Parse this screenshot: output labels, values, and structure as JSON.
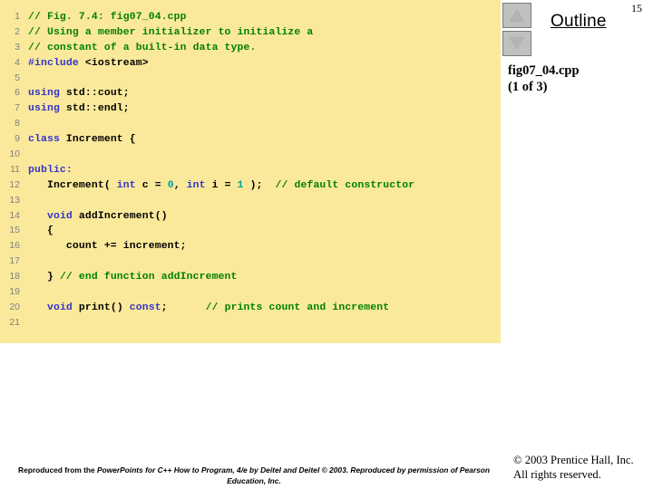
{
  "slide": {
    "page_number": "15"
  },
  "outline": {
    "title": "Outline",
    "file_name": "fig07_04.cpp",
    "file_progress": "(1 of 3)",
    "scroll_up_icon": "triangle-up-icon",
    "scroll_down_icon": "triangle-down-icon"
  },
  "code": {
    "background_color": "#fae99a",
    "line_number_color": "#808080",
    "colors": {
      "comment": "#008000",
      "keyword": "#3333cc",
      "number": "#00a0a0",
      "plain": "#000000"
    },
    "lines": [
      {
        "n": "1",
        "tokens": [
          {
            "t": "// Fig. 7.4: fig07_04.cpp",
            "c": "comment"
          }
        ]
      },
      {
        "n": "2",
        "tokens": [
          {
            "t": "// Using a member initializer to initialize a",
            "c": "comment"
          }
        ]
      },
      {
        "n": "3",
        "tokens": [
          {
            "t": "// constant of a built-in data type.",
            "c": "comment"
          }
        ]
      },
      {
        "n": "4",
        "tokens": [
          {
            "t": "#include ",
            "c": "keyword"
          },
          {
            "t": "<iostream>",
            "c": "plain"
          }
        ]
      },
      {
        "n": "5",
        "tokens": []
      },
      {
        "n": "6",
        "tokens": [
          {
            "t": "using",
            "c": "keyword"
          },
          {
            "t": " std::cout;",
            "c": "plain"
          }
        ]
      },
      {
        "n": "7",
        "tokens": [
          {
            "t": "using",
            "c": "keyword"
          },
          {
            "t": " std::endl;",
            "c": "plain"
          }
        ]
      },
      {
        "n": "8",
        "tokens": []
      },
      {
        "n": "9",
        "tokens": [
          {
            "t": "class",
            "c": "keyword"
          },
          {
            "t": " Increment {",
            "c": "plain"
          }
        ]
      },
      {
        "n": "10",
        "tokens": []
      },
      {
        "n": "11",
        "tokens": [
          {
            "t": "public:",
            "c": "keyword"
          }
        ]
      },
      {
        "n": "12",
        "tokens": [
          {
            "t": "   Increment( ",
            "c": "plain"
          },
          {
            "t": "int",
            "c": "keyword"
          },
          {
            "t": " c = ",
            "c": "plain"
          },
          {
            "t": "0",
            "c": "number"
          },
          {
            "t": ", ",
            "c": "plain"
          },
          {
            "t": "int",
            "c": "keyword"
          },
          {
            "t": " i = ",
            "c": "plain"
          },
          {
            "t": "1",
            "c": "number"
          },
          {
            "t": " );  ",
            "c": "plain"
          },
          {
            "t": "// default constructor",
            "c": "comment"
          }
        ]
      },
      {
        "n": "13",
        "tokens": []
      },
      {
        "n": "14",
        "tokens": [
          {
            "t": "   ",
            "c": "plain"
          },
          {
            "t": "void",
            "c": "keyword"
          },
          {
            "t": " addIncrement()",
            "c": "plain"
          }
        ]
      },
      {
        "n": "15",
        "tokens": [
          {
            "t": "   {",
            "c": "plain"
          }
        ]
      },
      {
        "n": "16",
        "tokens": [
          {
            "t": "      count += increment;",
            "c": "plain"
          }
        ]
      },
      {
        "n": "17",
        "tokens": []
      },
      {
        "n": "18",
        "tokens": [
          {
            "t": "   } ",
            "c": "plain"
          },
          {
            "t": "// end function addIncrement",
            "c": "comment"
          }
        ]
      },
      {
        "n": "19",
        "tokens": []
      },
      {
        "n": "20",
        "tokens": [
          {
            "t": "   ",
            "c": "plain"
          },
          {
            "t": "void",
            "c": "keyword"
          },
          {
            "t": " print() ",
            "c": "plain"
          },
          {
            "t": "const",
            "c": "keyword"
          },
          {
            "t": ";      ",
            "c": "plain"
          },
          {
            "t": "// prints count and increment",
            "c": "comment"
          }
        ]
      },
      {
        "n": "21",
        "tokens": []
      }
    ]
  },
  "footer": {
    "credit_line_1_prefix": "Reproduced from the ",
    "credit_line_1_italic": "PowerPoints for C++ How to Program, 4/e by Deitel and Deitel © 2003. Reproduced by permission of Pearson Education, Inc.",
    "copyright_line_1": "© 2003 Prentice Hall, Inc.",
    "copyright_line_2": "All rights reserved."
  }
}
